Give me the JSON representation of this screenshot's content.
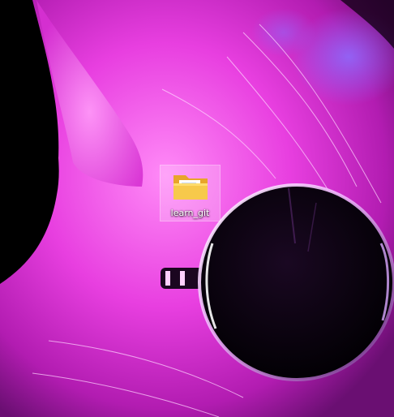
{
  "desktop": {
    "wallpaper": {
      "description_icon": "pink-cat-with-sunglasses-wallpaper",
      "colors": {
        "fur_bright": "#f56cf0",
        "fur_mid": "#e23fd9",
        "fur_deep": "#b51fb4",
        "background": "#000000",
        "accent_blue": "#7a5cff"
      }
    },
    "icons": [
      {
        "label": "learn_git",
        "icon": "folder-icon",
        "selected": true
      }
    ]
  }
}
